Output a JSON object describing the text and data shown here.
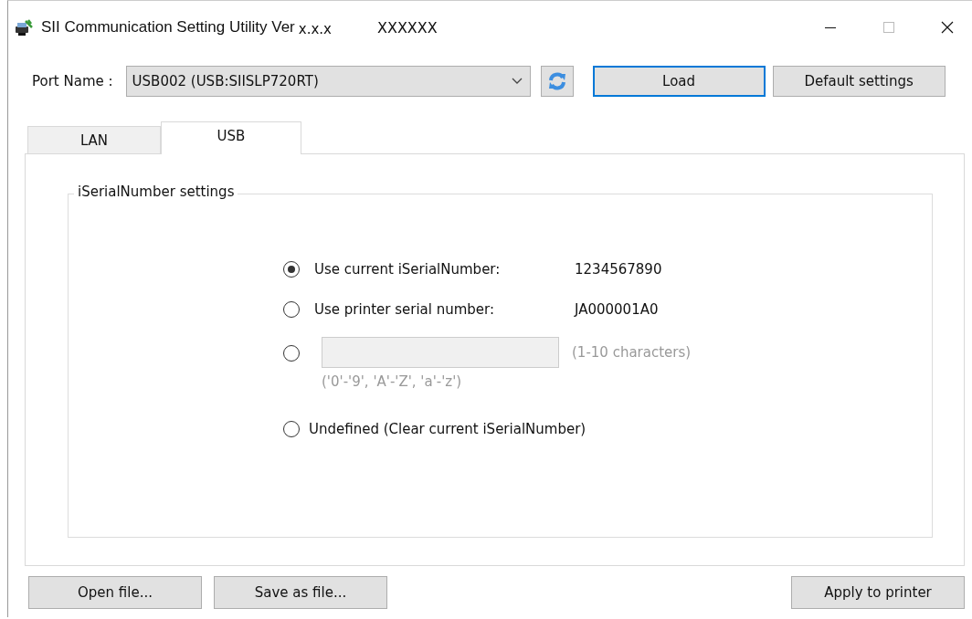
{
  "window": {
    "title": "SII Communication Setting Utility Ver",
    "version": "x.x.x",
    "build": "XXXXXX"
  },
  "port": {
    "label": "Port Name :",
    "value": "USB002 (USB:SIISLP720RT)"
  },
  "top_buttons": [
    "Load",
    "Default settings"
  ],
  "tabs": [
    {
      "label": "LAN",
      "selected": false
    },
    {
      "label": "USB",
      "selected": true
    }
  ],
  "group": {
    "title": "iSerialNumber settings",
    "options": [
      {
        "kind": "value",
        "label": "Use current iSerialNumber:",
        "value": "1234567890",
        "selected": true
      },
      {
        "kind": "value",
        "label": "Use printer serial number:",
        "value": "JA000001A0",
        "selected": false
      },
      {
        "kind": "custom",
        "disabled": true,
        "hint": "(1-10 characters)",
        "note": "('0'-'9', 'A'-'Z', 'a'-'z')",
        "selected": false
      },
      {
        "kind": "plain",
        "label": "Undefined (Clear current iSerialNumber)",
        "selected": false
      }
    ]
  },
  "bottom_buttons": {
    "left": [
      "Open file...",
      "Save as file..."
    ],
    "right": [
      "Apply to printer"
    ]
  }
}
